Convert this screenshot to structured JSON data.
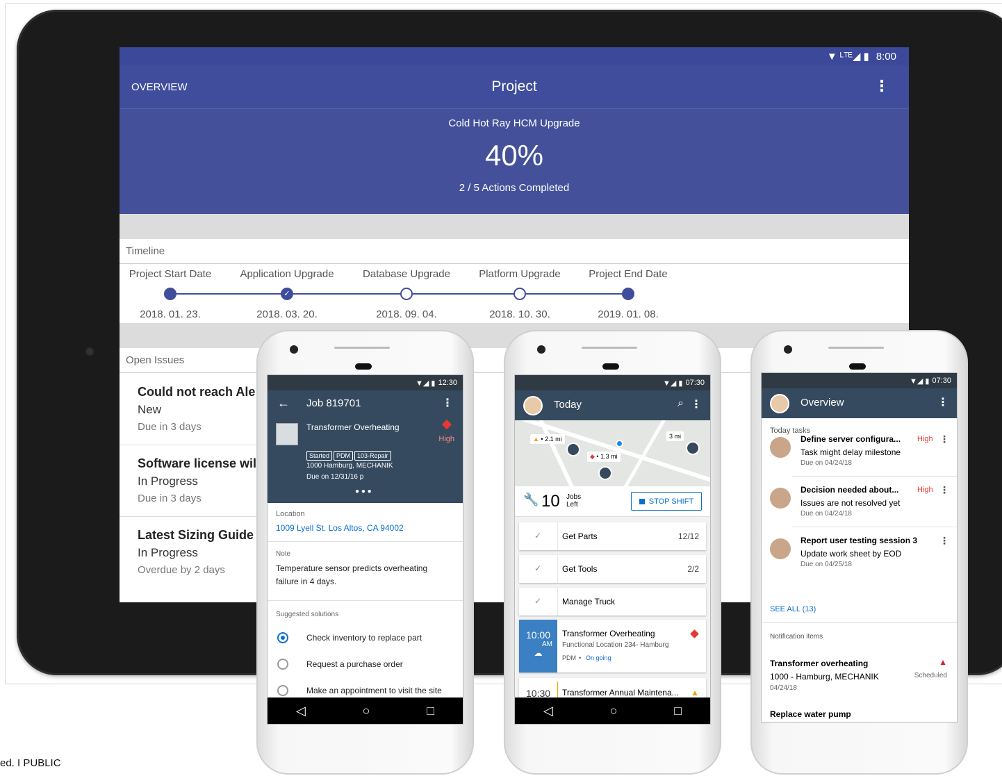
{
  "tablet": {
    "status_time": "8:00",
    "status_icons": "▼ ᴸᵀᴱ◢ ▮",
    "overview_label": "OVERVIEW",
    "title": "Project",
    "project_name": "Cold Hot Ray HCM Upgrade",
    "percent": "40%",
    "progress_value": 0.4,
    "actions": "2 / 5 Actions Completed",
    "timeline_title": "Timeline",
    "milestones": [
      {
        "label": "Project Start Date",
        "date": "2018. 01. 23.",
        "state": "filled"
      },
      {
        "label": "Application Upgrade",
        "date": "2018. 03. 20.",
        "state": "checked"
      },
      {
        "label": "Database Upgrade",
        "date": "2018. 09. 04.",
        "state": "open"
      },
      {
        "label": "Platform Upgrade",
        "date": "2018. 10. 30.",
        "state": "open"
      },
      {
        "label": "Project End Date",
        "date": "2019. 01. 08.",
        "state": "filled"
      }
    ],
    "issues_title": "Open Issues",
    "issues": [
      {
        "title": "Could not reach Ale",
        "status": "New",
        "due": "Due in 3 days"
      },
      {
        "title": "Software license wil",
        "status": "In Progress",
        "due": "Due in 3 days"
      },
      {
        "title": "Latest Sizing Guide",
        "status": "In Progress",
        "due": "Overdue by 2 days"
      }
    ]
  },
  "phone1": {
    "time": "12:30",
    "title": "Job 819701",
    "job_name": "Transformer Overheating",
    "priority": "High",
    "tags": [
      "Started",
      "PDM",
      "103-Repair"
    ],
    "address_line": "1000 Hamburg, MECHANIK",
    "due": "Due on 12/31/16 p",
    "location_label": "Location",
    "location_value": "1009 Lyell St. Los Altos, CA 94002",
    "note_label": "Note",
    "note_value": "Temperature sensor predicts overheating failure in 4 days.",
    "solutions_label": "Suggested solutions",
    "solutions": [
      {
        "text": "Check inventory to replace part",
        "selected": true
      },
      {
        "text": "Request a purchase order",
        "selected": false
      },
      {
        "text": "Make an appointment to visit the site",
        "selected": false
      }
    ]
  },
  "phone2": {
    "time": "07:30",
    "title": "Today",
    "map_labels": [
      "2.1 mi",
      "1.3 mi",
      "3 mi"
    ],
    "jobs_count": "10",
    "jobs_label_1": "Jobs",
    "jobs_label_2": "Left",
    "stop_shift": "STOP SHIFT",
    "checklist": [
      {
        "label": "Get Parts",
        "count": "12/12"
      },
      {
        "label": "Get Tools",
        "count": "2/2"
      },
      {
        "label": "Manage Truck",
        "count": ""
      }
    ],
    "job1": {
      "time": "10:00",
      "ampm": "AM",
      "title": "Transformer Overheating",
      "subtitle": "Functional Location 234- Hamburg",
      "tag": "PDM",
      "status": "On going"
    },
    "job2": {
      "time": "10:30",
      "title": "Transformer Annual Maintena..."
    }
  },
  "phone3": {
    "time": "07:30",
    "title": "Overview",
    "tasks_label": "Today tasks",
    "tasks": [
      {
        "title": "Define server configura...",
        "priority": "High",
        "sub": "Task might delay milestone",
        "due": "Due on 04/24/18"
      },
      {
        "title": "Decision needed about...",
        "priority": "High",
        "sub": "Issues are not resolved yet",
        "due": "Due on 04/24/18"
      },
      {
        "title": "Report user testing session 3",
        "priority": "",
        "sub": "Update work sheet by EOD",
        "due": "Due on 04/25/18"
      }
    ],
    "see_all": "SEE ALL (13)",
    "notif_label": "Notification items",
    "notif_title": "Transformer overheating",
    "notif_sub": "1000 - Hamburg, MECHANIK",
    "notif_status": "Scheduled",
    "notif_date": "04/24/18",
    "notif2_title": "Replace water pump"
  },
  "footer": "ed.  I  PUBLIC",
  "colors": {
    "primary": "#3f4d9c",
    "shell": "#354a5f",
    "accent": "#0a6ed1",
    "danger": "#e53935"
  }
}
